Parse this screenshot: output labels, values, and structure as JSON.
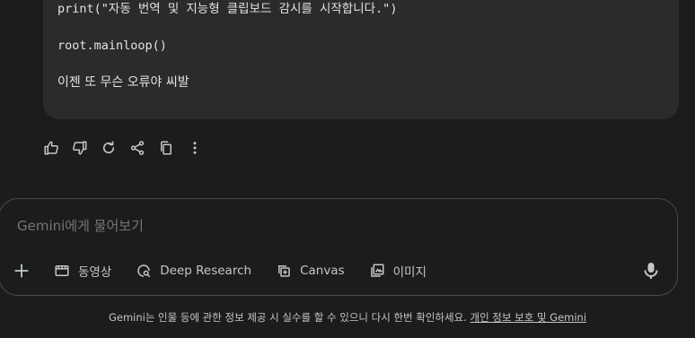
{
  "message": {
    "lines": [
      "print(\"자동 번역 및 지능형 클립보드 감시를 시작합니다.\")",
      "root.mainloop()",
      "이젠 또 무슨 오류야 씨발"
    ]
  },
  "actions": [
    "thumbs-up-icon",
    "thumbs-down-icon",
    "regenerate-icon",
    "share-icon",
    "copy-icon",
    "more-vert-icon"
  ],
  "input": {
    "placeholder": "Gemini에게 물어보기"
  },
  "toolbar": {
    "video_label": "동영상",
    "research_label": "Deep Research",
    "canvas_label": "Canvas",
    "image_label": "이미지"
  },
  "footer": {
    "disclaimer": "Gemini는 인물 등에 관한 정보 제공 시 실수를 할 수 있으니 다시 한번 확인하세요.",
    "link": "개인 정보 보호 및 Gemini"
  },
  "colors": {
    "background": "#1b1c1d",
    "bubble": "#2a2b2d",
    "text": "#e3e3e3",
    "muted": "#c4c7c5",
    "border": "#4a4b4d"
  }
}
